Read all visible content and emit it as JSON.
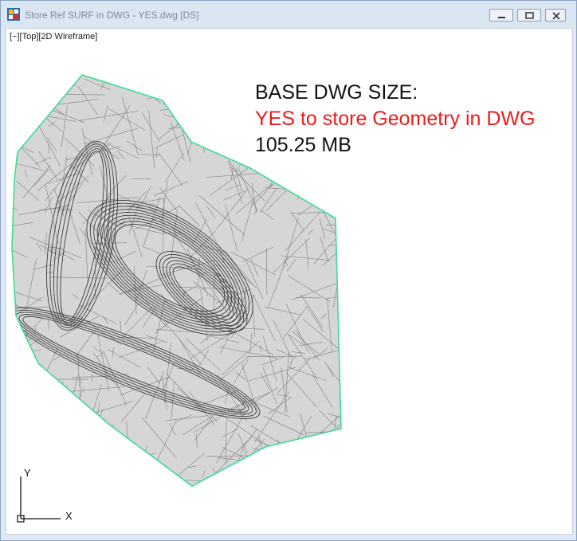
{
  "window": {
    "title": "Store Ref SURF in DWG - YES.dwg [DS]",
    "icon": "autocad-app-icon",
    "controls": {
      "minimize": "minimize-icon",
      "restore": "restore-icon",
      "close": "close-icon"
    }
  },
  "viewport": {
    "label": "[−][Top][2D Wireframe]",
    "annotation": {
      "line1": "BASE DWG SIZE:",
      "line2": "YES to store Geometry  in DWG",
      "line3": "105.25 MB"
    },
    "colors": {
      "boundary": "#3ddc97",
      "mesh": "#808080",
      "mesh_dense": "#3c3c3c",
      "text_red": "#ee1b1b"
    },
    "ucs": {
      "x_label": "X",
      "y_label": "Y"
    }
  }
}
